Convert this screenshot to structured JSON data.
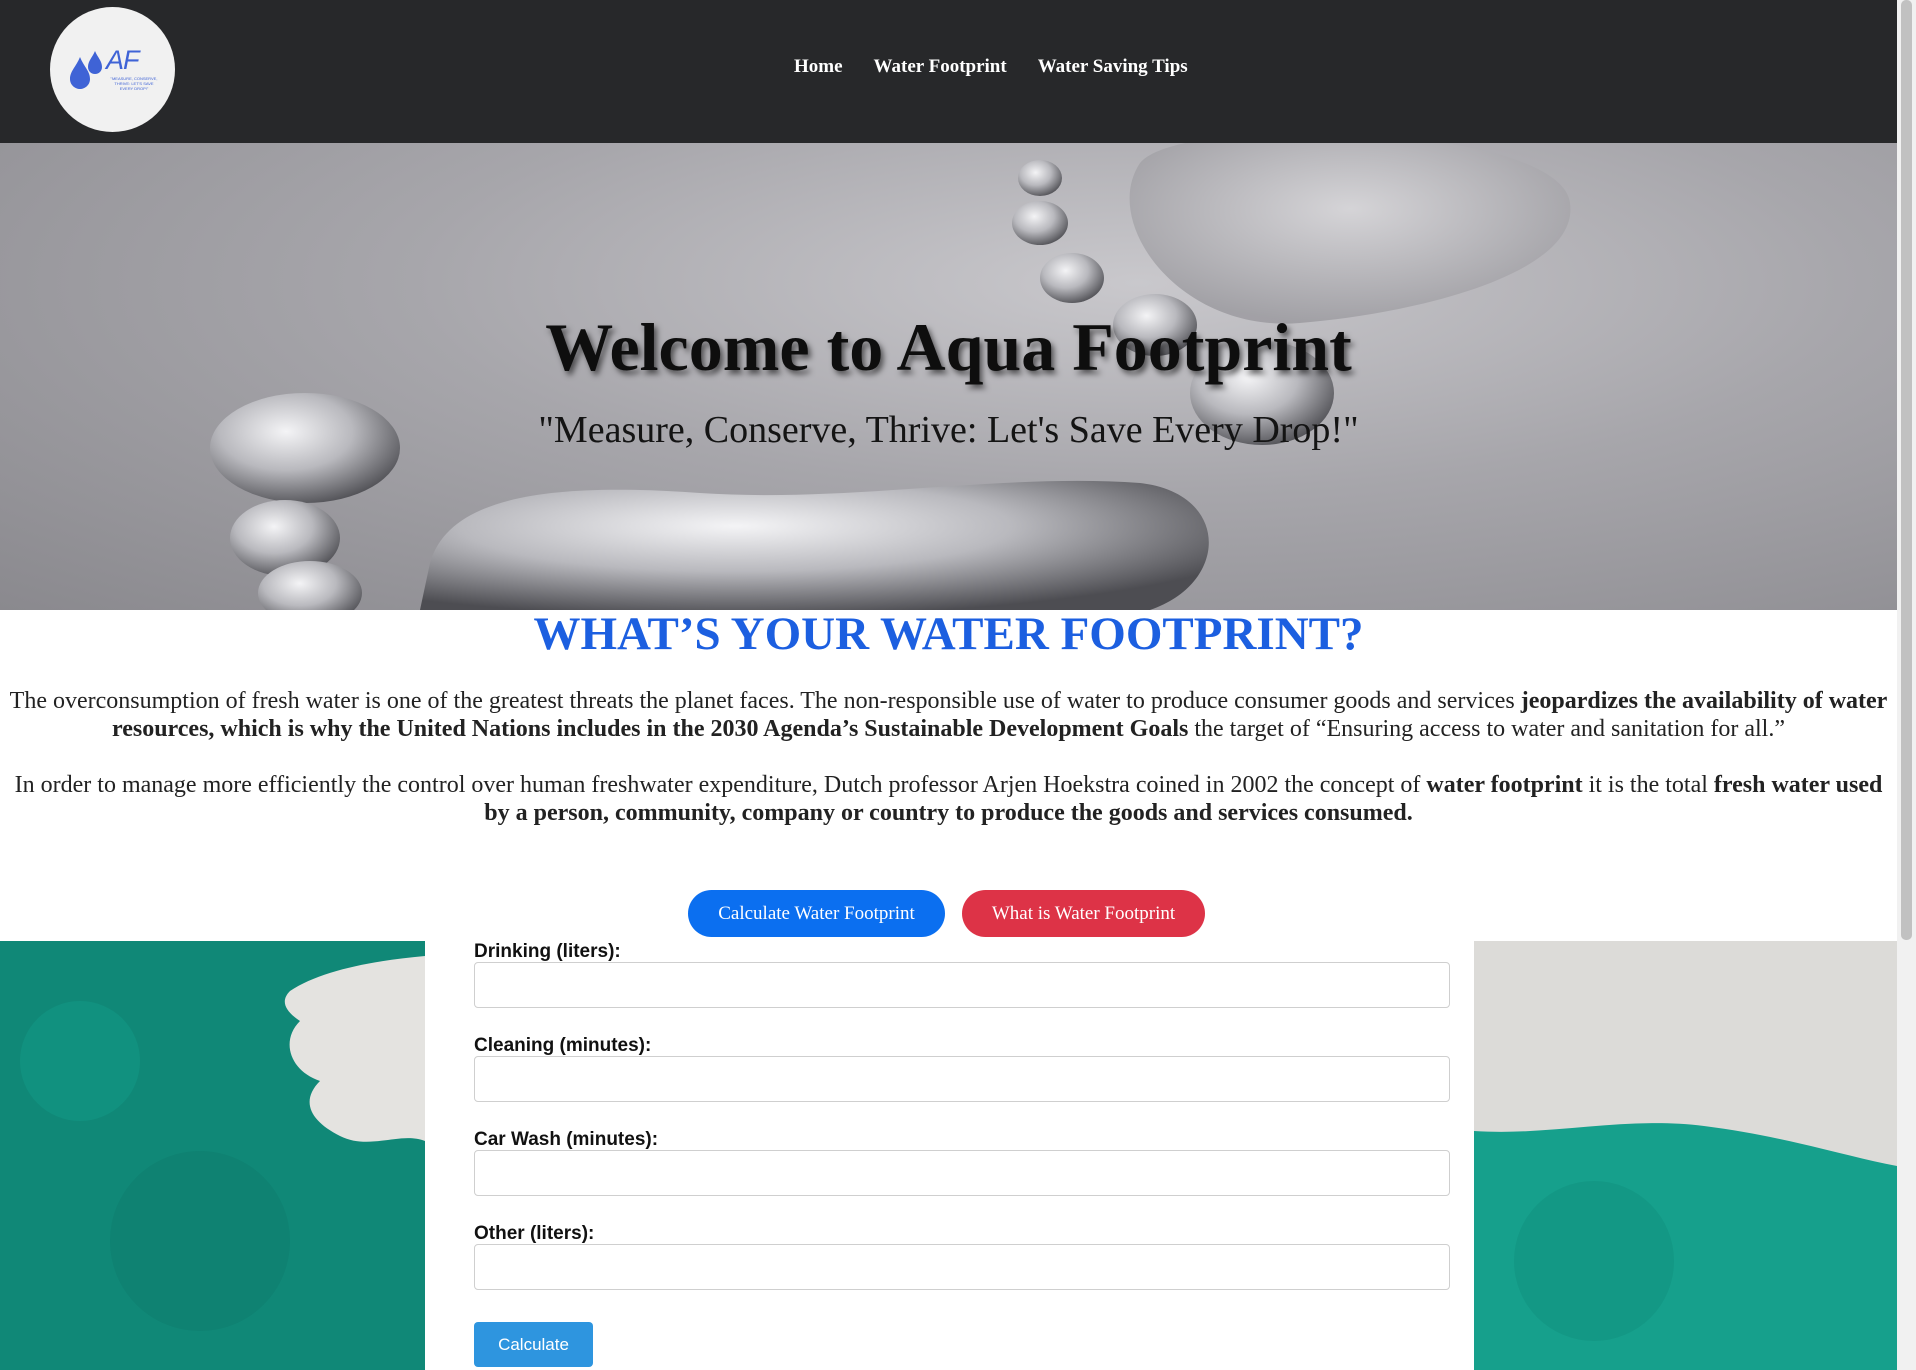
{
  "header": {
    "logo": {
      "text": "AF",
      "tagline": "\"MEASURE, CONSERVE, THRIVE: LET'S SAVE EVERY DROP!\""
    },
    "nav": [
      "Home",
      "Water Footprint",
      "Water Saving Tips"
    ]
  },
  "hero": {
    "title": "Welcome to Aqua Footprint",
    "subtitle": "\"Measure, Conserve, Thrive: Let's Save Every Drop!\""
  },
  "content": {
    "heading": "WHAT’S YOUR WATER FOOTPRINT?",
    "p1": {
      "a": "The overconsumption of fresh water is one of the greatest threats the planet faces. The non-responsible use of water to produce consumer goods and services ",
      "b": "jeopardizes the availability of water resources, which is why the United Nations includes in the 2030 Agenda’s Sustainable Development Goals",
      "c": " the target of “Ensuring access to water and sanitation for all.”"
    },
    "p2": {
      "a": "In order to manage more efficiently the control over human freshwater expenditure, Dutch professor Arjen Hoekstra coined in 2002 the concept of ",
      "b": "water footprint",
      "c": " it is the total ",
      "d": "fresh water used by a person, community, company or country to produce the goods and services consumed."
    }
  },
  "buttons": {
    "calculate": "Calculate Water Footprint",
    "what": "What is Water Footprint"
  },
  "form": {
    "fields": [
      {
        "label": "Drinking (liters):",
        "value": ""
      },
      {
        "label": "Cleaning (minutes):",
        "value": ""
      },
      {
        "label": "Car Wash (minutes):",
        "value": ""
      },
      {
        "label": "Other (liters):",
        "value": ""
      }
    ],
    "submit": "Calculate"
  },
  "colors": {
    "header": "#27282a",
    "heading": "#1c5fe0",
    "btn_blue": "#0b6ff0",
    "btn_red": "#dd3347",
    "submit": "#2e95df"
  }
}
